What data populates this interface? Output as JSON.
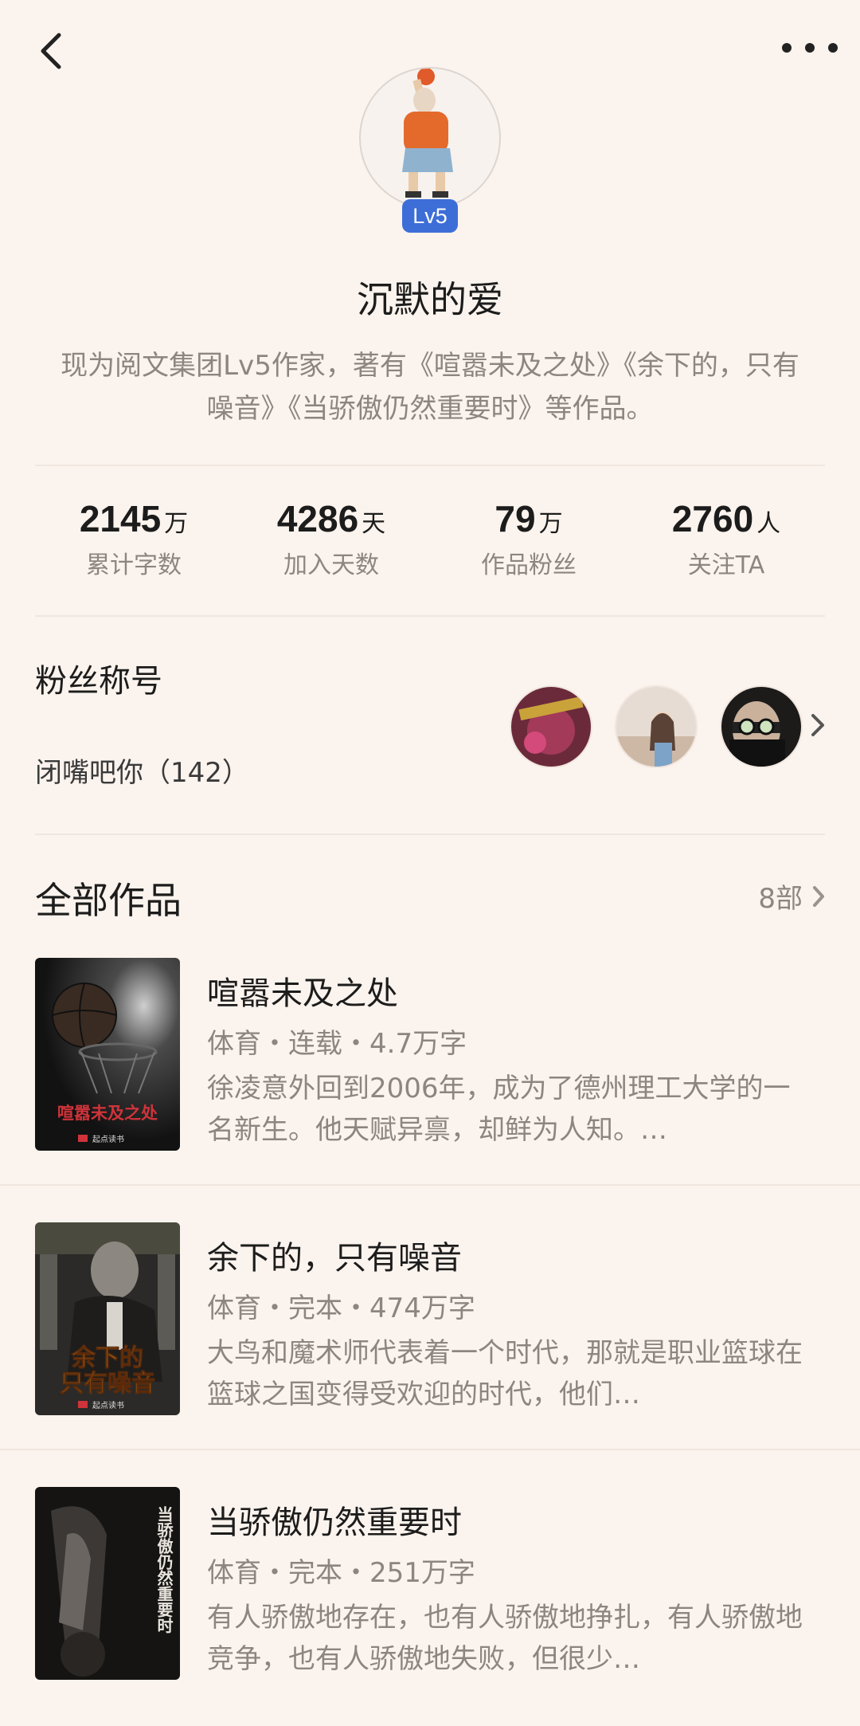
{
  "header": {
    "level_badge": "Lv5",
    "username": "沉默的爱",
    "bio": "现为阅文集团Lv5作家，著有《喧嚣未及之处》《余下的，只有噪音》《当骄傲仍然重要时》等作品。"
  },
  "stats": [
    {
      "value": "2145",
      "unit": "万",
      "label": "累计字数"
    },
    {
      "value": "4286",
      "unit": "天",
      "label": "加入天数"
    },
    {
      "value": "79",
      "unit": "万",
      "label": "作品粉丝"
    },
    {
      "value": "2760",
      "unit": "人",
      "label": "关注TA"
    }
  ],
  "fans": {
    "title": "粉丝称号",
    "name": "闭嘴吧你（142）"
  },
  "works": {
    "title": "全部作品",
    "count": "8部",
    "books": [
      {
        "title": "喧嚣未及之处",
        "meta": "体育・连载・4.7万字",
        "desc": "徐凌意外回到2006年，成为了德州理工大学的一名新生。他天赋异禀，却鲜为人知。…",
        "cover_text": "喧嚣未及之处",
        "cover_publisher": "起点读书"
      },
      {
        "title": "余下的，只有噪音",
        "meta": "体育・完本・474万字",
        "desc": "大鸟和魔术师代表着一个时代，那就是职业篮球在篮球之国变得受欢迎的时代，他们…",
        "cover_text_1": "余下的",
        "cover_text_2": "只有噪音",
        "cover_publisher": "起点读书"
      },
      {
        "title": "当骄傲仍然重要时",
        "meta": "体育・完本・251万字",
        "desc": "有人骄傲地存在，也有人骄傲地挣扎，有人骄傲地竞争，也有人骄傲地失败，但很少…",
        "cover_text": "当骄傲仍然重要时"
      }
    ]
  }
}
